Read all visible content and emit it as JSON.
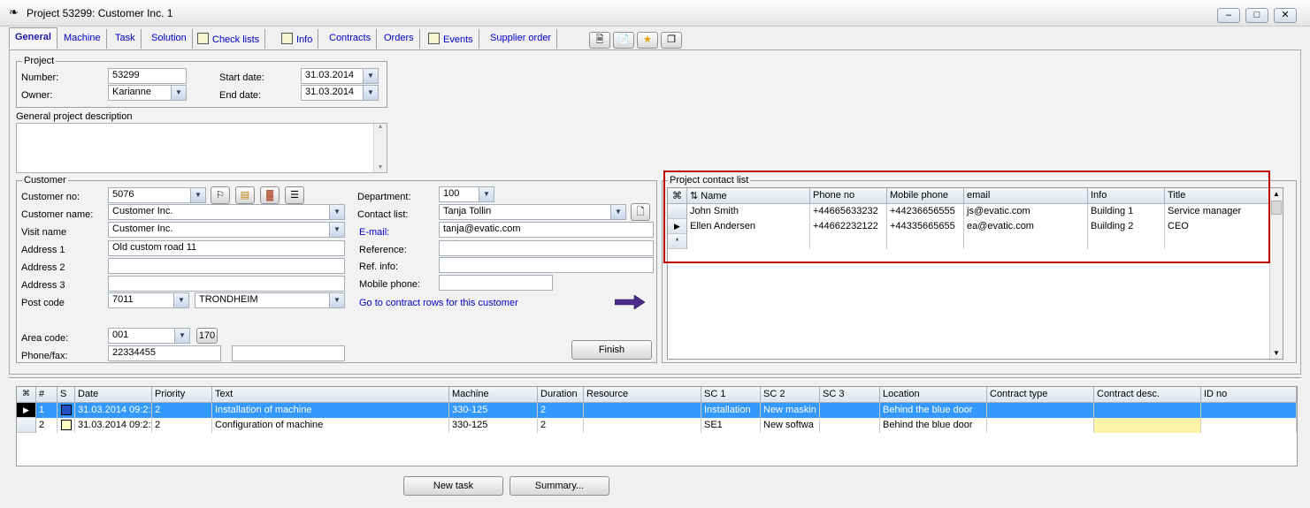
{
  "window": {
    "title": "Project 53299: Customer Inc. 1",
    "controls": [
      "minimize",
      "maximize",
      "close"
    ]
  },
  "tabs": [
    {
      "label": "General",
      "active": true
    },
    {
      "label": "Machine"
    },
    {
      "label": "Task"
    },
    {
      "label": "Solution"
    },
    {
      "label": "Check lists",
      "icon": "checklist-icon"
    },
    {
      "label": "Info",
      "icon": "magnifier-icon"
    },
    {
      "label": "Contracts"
    },
    {
      "label": "Orders"
    },
    {
      "label": "Events",
      "icon": "printer-icon"
    },
    {
      "label": "Supplier order"
    }
  ],
  "toolbar_icons": [
    "notepad-icon",
    "document-icon",
    "star-icon",
    "copy-icon"
  ],
  "project": {
    "legend": "Project",
    "number_label": "Number:",
    "number": "53299",
    "owner_label": "Owner:",
    "owner": "Karianne",
    "start_label": "Start date:",
    "start": "31.03.2014",
    "end_label": "End date:",
    "end": "31.03.2014"
  },
  "description_label": "General project description",
  "customer": {
    "legend": "Customer",
    "no_label": "Customer no:",
    "no": "5076",
    "name_label": "Customer name:",
    "name": "Customer Inc.",
    "visit_label": "Visit name",
    "visit": "Customer Inc.",
    "addr1_label": "Address 1",
    "addr1": "Old custom road 11",
    "addr2_label": "Address 2",
    "addr2": "",
    "addr3_label": "Address 3",
    "addr3": "",
    "post_label": "Post code",
    "post": "7011",
    "city": "TRONDHEIM",
    "area_label": "Area code:",
    "area": "001",
    "area_btn": "170",
    "phone_label": "Phone/fax:",
    "phone": "22334455",
    "fax": "",
    "dept_label": "Department:",
    "dept": "100",
    "contact_label": "Contact list:",
    "contact": "Tanja Tollin",
    "email_label": "E-mail:",
    "email": "tanja@evatic.com",
    "ref_label": "Reference:",
    "ref": "",
    "refinfo_label": "Ref. info:",
    "refinfo": "",
    "mobile_label": "Mobile phone:",
    "mobile": "",
    "contract_link": "Go to contract rows for this customer",
    "finish": "Finish"
  },
  "contacts": {
    "legend": "Project contact list",
    "columns": [
      "Name",
      "Phone no",
      "Mobile phone",
      "email",
      "Info",
      "Title"
    ],
    "rows": [
      [
        "John Smith",
        "+44665633232",
        "+44236656555",
        "js@evatic.com",
        "Building 1",
        "Service manager"
      ],
      [
        "Ellen Andersen",
        "+44662232122",
        "+44335665655",
        "ea@evatic.com",
        "Building 2",
        "CEO"
      ]
    ],
    "new_row_marker": "*"
  },
  "tasks": {
    "columns": [
      "#",
      "S",
      "Date",
      "Priority",
      "Text",
      "Machine",
      "Duration",
      "Resource",
      "SC 1",
      "SC 2",
      "SC 3",
      "Location",
      "Contract type",
      "Contract desc.",
      "ID no"
    ],
    "rows": [
      [
        "1",
        "",
        "31.03.2014 09:2:",
        "2",
        "Installation of machine",
        "330-125",
        "2",
        "",
        "Installation",
        "New maskin",
        "",
        "Behind the blue door",
        "",
        "",
        ""
      ],
      [
        "2",
        "",
        "31.03.2014 09:2:",
        "2",
        "Configuration of machine",
        "330-125",
        "2",
        "",
        "SE1",
        "New softwa",
        "",
        "Behind the blue door",
        "",
        "",
        ""
      ]
    ],
    "status_colors": [
      "#2050c0",
      "#ffffc0"
    ],
    "highlight_color": "#fff5a8"
  },
  "buttons": {
    "new_task": "New task",
    "summary": "Summary..."
  }
}
